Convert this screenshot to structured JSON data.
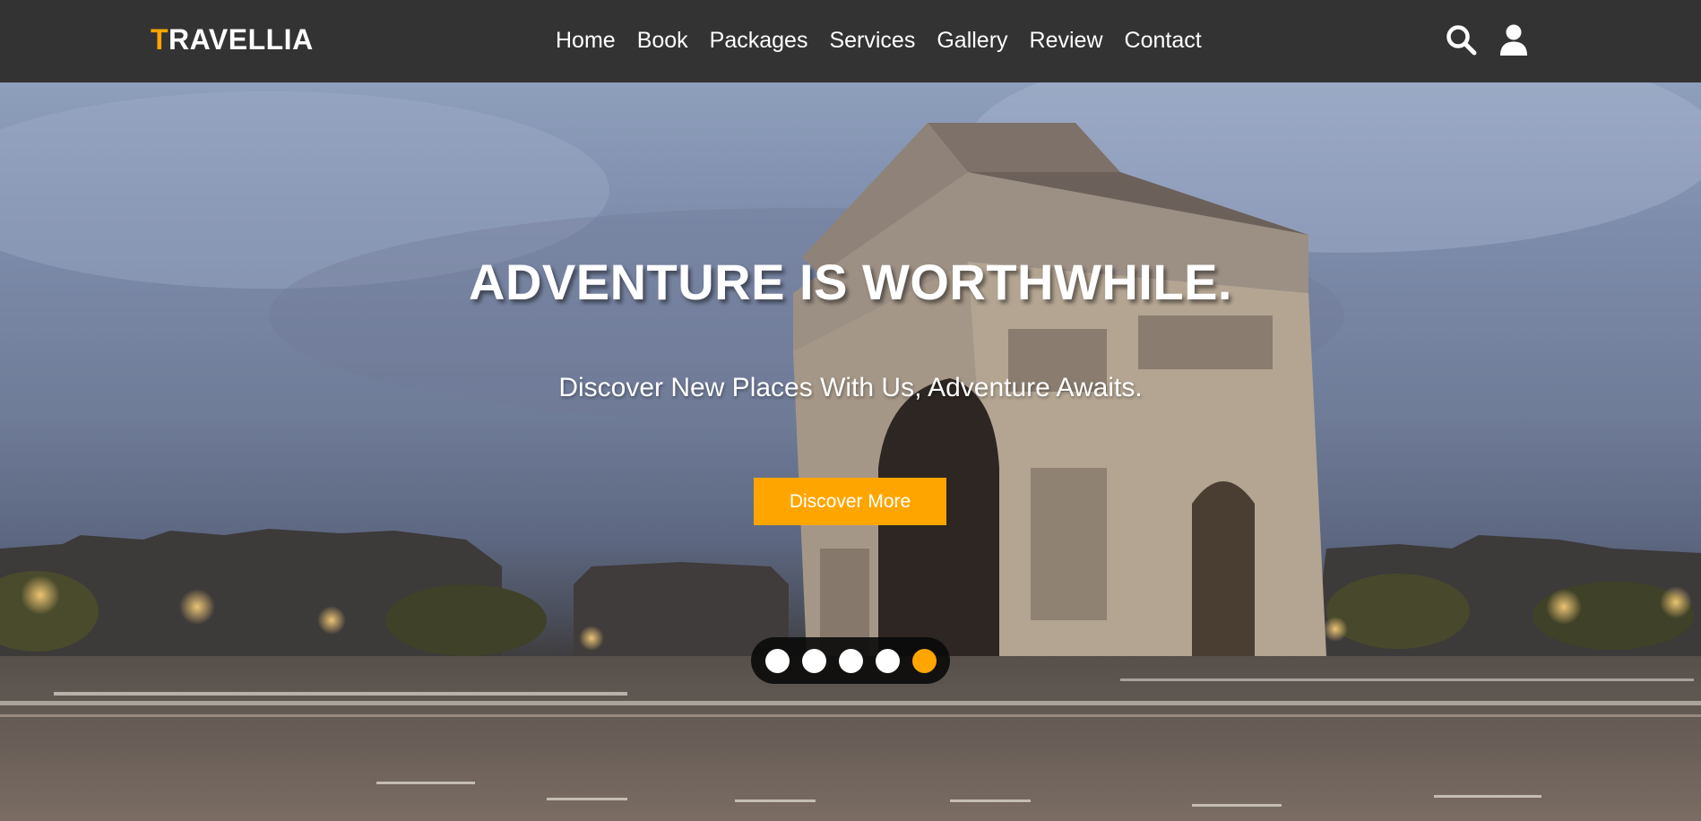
{
  "brand": {
    "logo_first": "T",
    "logo_rest": "RAVELLIA"
  },
  "nav": {
    "items": [
      "Home",
      "Book",
      "Packages",
      "Services",
      "Gallery",
      "Review",
      "Contact"
    ]
  },
  "hero": {
    "title": "ADVENTURE IS WORTHWHILE.",
    "subtitle": "Discover New Places With Us, Adventure Awaits.",
    "cta_label": "Discover More",
    "slides_total": 5,
    "active_slide": 5
  },
  "icons": {
    "search": "search-icon",
    "user": "user-icon"
  },
  "colors": {
    "accent": "#ffa500",
    "header_bg": "#333333",
    "text": "#ffffff"
  }
}
